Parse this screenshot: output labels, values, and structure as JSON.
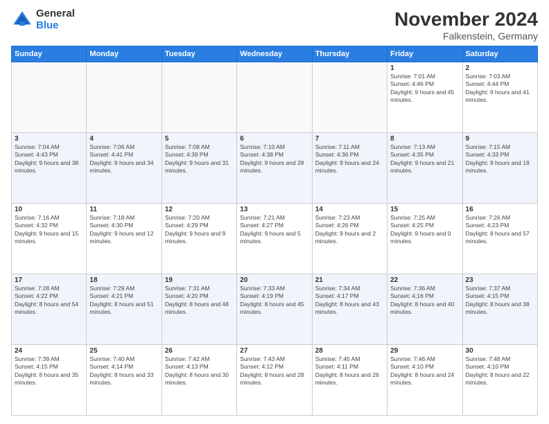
{
  "header": {
    "logo_general": "General",
    "logo_blue": "Blue",
    "main_title": "November 2024",
    "subtitle": "Falkenstein, Germany"
  },
  "weekdays": [
    "Sunday",
    "Monday",
    "Tuesday",
    "Wednesday",
    "Thursday",
    "Friday",
    "Saturday"
  ],
  "weeks": [
    [
      {
        "day": "",
        "info": ""
      },
      {
        "day": "",
        "info": ""
      },
      {
        "day": "",
        "info": ""
      },
      {
        "day": "",
        "info": ""
      },
      {
        "day": "",
        "info": ""
      },
      {
        "day": "1",
        "info": "Sunrise: 7:01 AM\nSunset: 4:46 PM\nDaylight: 9 hours and 45 minutes."
      },
      {
        "day": "2",
        "info": "Sunrise: 7:03 AM\nSunset: 4:44 PM\nDaylight: 9 hours and 41 minutes."
      }
    ],
    [
      {
        "day": "3",
        "info": "Sunrise: 7:04 AM\nSunset: 4:43 PM\nDaylight: 9 hours and 38 minutes."
      },
      {
        "day": "4",
        "info": "Sunrise: 7:06 AM\nSunset: 4:41 PM\nDaylight: 9 hours and 34 minutes."
      },
      {
        "day": "5",
        "info": "Sunrise: 7:08 AM\nSunset: 4:39 PM\nDaylight: 9 hours and 31 minutes."
      },
      {
        "day": "6",
        "info": "Sunrise: 7:10 AM\nSunset: 4:38 PM\nDaylight: 9 hours and 28 minutes."
      },
      {
        "day": "7",
        "info": "Sunrise: 7:11 AM\nSunset: 4:36 PM\nDaylight: 9 hours and 24 minutes."
      },
      {
        "day": "8",
        "info": "Sunrise: 7:13 AM\nSunset: 4:35 PM\nDaylight: 9 hours and 21 minutes."
      },
      {
        "day": "9",
        "info": "Sunrise: 7:15 AM\nSunset: 4:33 PM\nDaylight: 9 hours and 18 minutes."
      }
    ],
    [
      {
        "day": "10",
        "info": "Sunrise: 7:16 AM\nSunset: 4:32 PM\nDaylight: 9 hours and 15 minutes."
      },
      {
        "day": "11",
        "info": "Sunrise: 7:18 AM\nSunset: 4:30 PM\nDaylight: 9 hours and 12 minutes."
      },
      {
        "day": "12",
        "info": "Sunrise: 7:20 AM\nSunset: 4:29 PM\nDaylight: 9 hours and 9 minutes."
      },
      {
        "day": "13",
        "info": "Sunrise: 7:21 AM\nSunset: 4:27 PM\nDaylight: 9 hours and 5 minutes."
      },
      {
        "day": "14",
        "info": "Sunrise: 7:23 AM\nSunset: 4:26 PM\nDaylight: 9 hours and 2 minutes."
      },
      {
        "day": "15",
        "info": "Sunrise: 7:25 AM\nSunset: 4:25 PM\nDaylight: 9 hours and 0 minutes."
      },
      {
        "day": "16",
        "info": "Sunrise: 7:26 AM\nSunset: 4:23 PM\nDaylight: 8 hours and 57 minutes."
      }
    ],
    [
      {
        "day": "17",
        "info": "Sunrise: 7:28 AM\nSunset: 4:22 PM\nDaylight: 8 hours and 54 minutes."
      },
      {
        "day": "18",
        "info": "Sunrise: 7:29 AM\nSunset: 4:21 PM\nDaylight: 8 hours and 51 minutes."
      },
      {
        "day": "19",
        "info": "Sunrise: 7:31 AM\nSunset: 4:20 PM\nDaylight: 8 hours and 48 minutes."
      },
      {
        "day": "20",
        "info": "Sunrise: 7:33 AM\nSunset: 4:19 PM\nDaylight: 8 hours and 45 minutes."
      },
      {
        "day": "21",
        "info": "Sunrise: 7:34 AM\nSunset: 4:17 PM\nDaylight: 8 hours and 43 minutes."
      },
      {
        "day": "22",
        "info": "Sunrise: 7:36 AM\nSunset: 4:16 PM\nDaylight: 8 hours and 40 minutes."
      },
      {
        "day": "23",
        "info": "Sunrise: 7:37 AM\nSunset: 4:15 PM\nDaylight: 8 hours and 38 minutes."
      }
    ],
    [
      {
        "day": "24",
        "info": "Sunrise: 7:39 AM\nSunset: 4:15 PM\nDaylight: 8 hours and 35 minutes."
      },
      {
        "day": "25",
        "info": "Sunrise: 7:40 AM\nSunset: 4:14 PM\nDaylight: 8 hours and 33 minutes."
      },
      {
        "day": "26",
        "info": "Sunrise: 7:42 AM\nSunset: 4:13 PM\nDaylight: 8 hours and 30 minutes."
      },
      {
        "day": "27",
        "info": "Sunrise: 7:43 AM\nSunset: 4:12 PM\nDaylight: 8 hours and 28 minutes."
      },
      {
        "day": "28",
        "info": "Sunrise: 7:45 AM\nSunset: 4:11 PM\nDaylight: 8 hours and 26 minutes."
      },
      {
        "day": "29",
        "info": "Sunrise: 7:46 AM\nSunset: 4:10 PM\nDaylight: 8 hours and 24 minutes."
      },
      {
        "day": "30",
        "info": "Sunrise: 7:48 AM\nSunset: 4:10 PM\nDaylight: 8 hours and 22 minutes."
      }
    ]
  ]
}
